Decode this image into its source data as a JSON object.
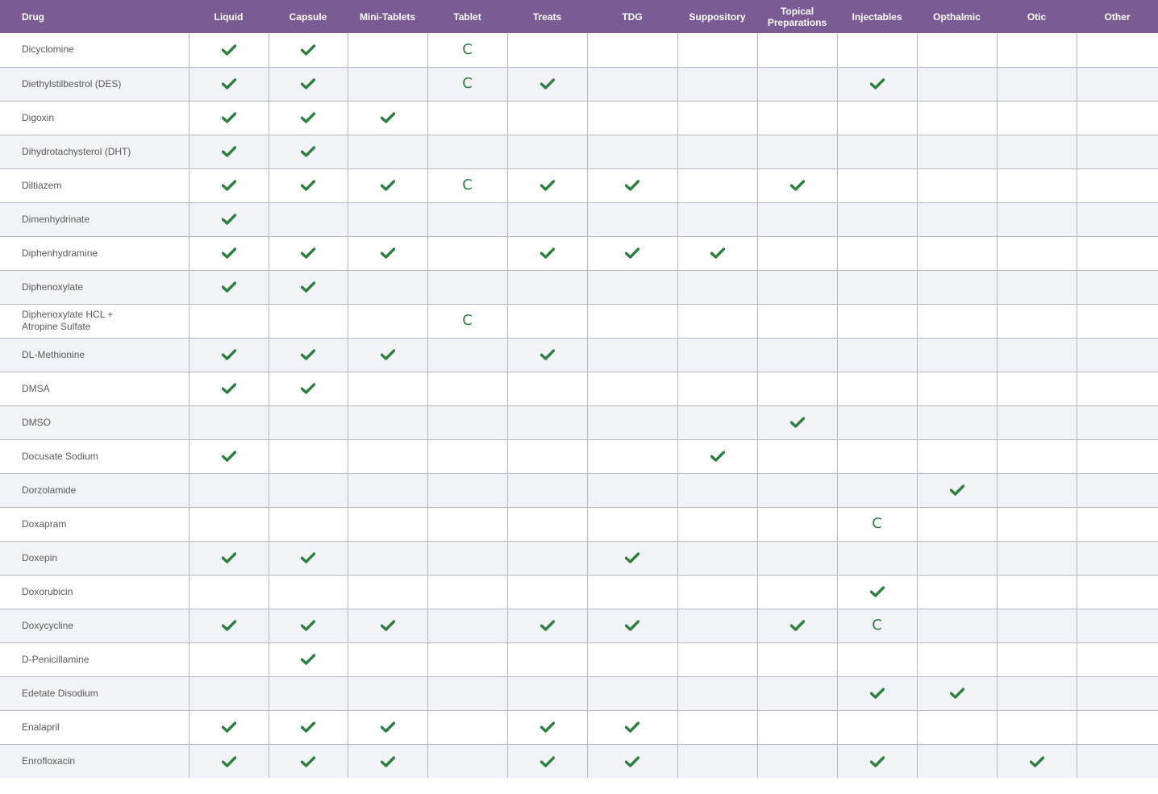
{
  "columns": [
    "Drug",
    "Liquid",
    "Capsule",
    "Mini-Tablets",
    "Tablet",
    "Treats",
    "TDG",
    "Suppository",
    "Topical Preparations",
    "Injectables",
    "Opthalmic",
    "Otic",
    "Other"
  ],
  "legend": {
    "check": "check-icon",
    "C": "C"
  },
  "colors": {
    "header": "#7a5b94",
    "check": "#2e8040",
    "stripe": "#f2f3f6"
  },
  "rows": [
    {
      "drug": "Dicyclomine",
      "cells": [
        "check",
        "check",
        "",
        "C",
        "",
        "",
        "",
        "",
        "",
        "",
        "",
        ""
      ]
    },
    {
      "drug": "Diethylstilbestrol (DES)",
      "cells": [
        "check",
        "check",
        "",
        "C",
        "check",
        "",
        "",
        "",
        "check",
        "",
        "",
        ""
      ]
    },
    {
      "drug": "Digoxin",
      "cells": [
        "check",
        "check",
        "check",
        "",
        "",
        "",
        "",
        "",
        "",
        "",
        "",
        ""
      ]
    },
    {
      "drug": "Dihydrotachysterol (DHT)",
      "cells": [
        "check",
        "check",
        "",
        "",
        "",
        "",
        "",
        "",
        "",
        "",
        "",
        ""
      ]
    },
    {
      "drug": "Diltiazem",
      "cells": [
        "check",
        "check",
        "check",
        "C",
        "check",
        "check",
        "",
        "check",
        "",
        "",
        "",
        ""
      ]
    },
    {
      "drug": "Dimenhydrinate",
      "cells": [
        "check",
        "",
        "",
        "",
        "",
        "",
        "",
        "",
        "",
        "",
        "",
        ""
      ]
    },
    {
      "drug": "Diphenhydramine",
      "cells": [
        "check",
        "check",
        "check",
        "",
        "check",
        "check",
        "check",
        "",
        "",
        "",
        "",
        ""
      ]
    },
    {
      "drug": "Diphenoxylate",
      "cells": [
        "check",
        "check",
        "",
        "",
        "",
        "",
        "",
        "",
        "",
        "",
        "",
        ""
      ]
    },
    {
      "drug": "Diphenoxylate HCL + Atropine Sulfate",
      "cells": [
        "",
        "",
        "",
        "C",
        "",
        "",
        "",
        "",
        "",
        "",
        "",
        ""
      ]
    },
    {
      "drug": "DL-Methionine",
      "cells": [
        "check",
        "check",
        "check",
        "",
        "check",
        "",
        "",
        "",
        "",
        "",
        "",
        ""
      ]
    },
    {
      "drug": "DMSA",
      "cells": [
        "check",
        "check",
        "",
        "",
        "",
        "",
        "",
        "",
        "",
        "",
        "",
        ""
      ]
    },
    {
      "drug": "DMSO",
      "cells": [
        "",
        "",
        "",
        "",
        "",
        "",
        "",
        "check",
        "",
        "",
        "",
        ""
      ]
    },
    {
      "drug": "Docusate Sodium",
      "cells": [
        "check",
        "",
        "",
        "",
        "",
        "",
        "check",
        "",
        "",
        "",
        "",
        ""
      ]
    },
    {
      "drug": "Dorzolamide",
      "cells": [
        "",
        "",
        "",
        "",
        "",
        "",
        "",
        "",
        "",
        "check",
        "",
        ""
      ]
    },
    {
      "drug": "Doxapram",
      "cells": [
        "",
        "",
        "",
        "",
        "",
        "",
        "",
        "",
        "C",
        "",
        "",
        ""
      ]
    },
    {
      "drug": "Doxepin",
      "cells": [
        "check",
        "check",
        "",
        "",
        "",
        "check",
        "",
        "",
        "",
        "",
        "",
        ""
      ]
    },
    {
      "drug": "Doxorubicin",
      "cells": [
        "",
        "",
        "",
        "",
        "",
        "",
        "",
        "",
        "check",
        "",
        "",
        ""
      ]
    },
    {
      "drug": "Doxycycline",
      "cells": [
        "check",
        "check",
        "check",
        "",
        "check",
        "check",
        "",
        "check",
        "C",
        "",
        "",
        ""
      ]
    },
    {
      "drug": "D-Penicillamine",
      "cells": [
        "",
        "check",
        "",
        "",
        "",
        "",
        "",
        "",
        "",
        "",
        "",
        ""
      ]
    },
    {
      "drug": "Edetate Disodium",
      "cells": [
        "",
        "",
        "",
        "",
        "",
        "",
        "",
        "",
        "check",
        "check",
        "",
        ""
      ]
    },
    {
      "drug": "Enalapril",
      "cells": [
        "check",
        "check",
        "check",
        "",
        "check",
        "check",
        "",
        "",
        "",
        "",
        "",
        ""
      ]
    },
    {
      "drug": "Enrofloxacin",
      "cells": [
        "check",
        "check",
        "check",
        "",
        "check",
        "check",
        "",
        "",
        "check",
        "",
        "check",
        ""
      ]
    }
  ]
}
